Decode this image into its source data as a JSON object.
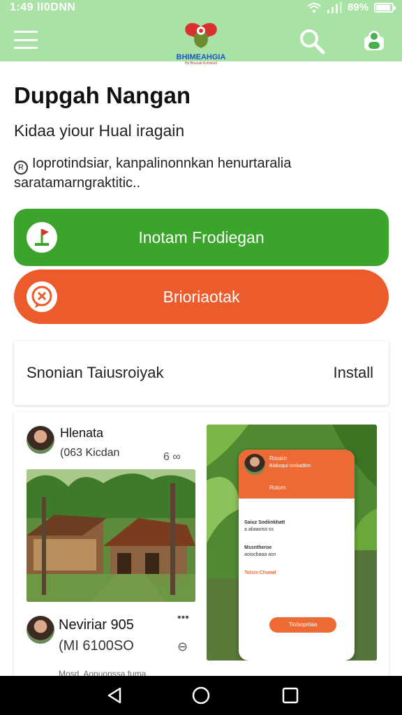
{
  "status_bar": {
    "time": "1:49 lI0DNN",
    "battery": "89%",
    "battery_level": 0.85
  },
  "app_bar": {
    "menu_icon": "hamburger-menu-icon",
    "logo": {
      "text": "BHIMEAHGIA",
      "subtext": "Hp Bnuvak Kohsiwet"
    },
    "search_icon": "search-icon",
    "profile_icon": "profile-icon"
  },
  "header": {
    "title": "Dupgah Nangan",
    "subtitle": "Kidaa yiour Hual iragain",
    "description": "Ioprotindsiar, kanpalinonnkan henurtaralia saratamarngraktitic..",
    "description_icon": "info-icon"
  },
  "buttons": {
    "primary": {
      "label": "Inotam Frodiegan",
      "icon": "flag-icon",
      "color": "#3aa52a"
    },
    "secondary": {
      "label": "Brioriaotak",
      "icon": "chat-bubble-icon",
      "color": "#ec5b2b"
    }
  },
  "install_card": {
    "label": "Snonian Taiusroiyak",
    "action": "Install"
  },
  "feed": {
    "posts": [
      {
        "name": "Hlenata",
        "meta": "(063 Kicdan",
        "action": "6 ∞"
      },
      {
        "name": "Neviriar 905",
        "meta": "(MI 6100SO",
        "action": "⊖",
        "more": "•••"
      }
    ],
    "footer_text": "Mosd. Aopuonssa fuma",
    "phone_preview": {
      "header_title": "Rousin",
      "header_sub": "Blakoqui Ionkadtim",
      "tab_label": "Rolom",
      "list_items": [
        {
          "title": "Saiuz Sodiinkhatt",
          "sub": "a aliaaoiss ss"
        },
        {
          "title": "Mssntheroe",
          "sub": "aoiocbaaa asn"
        },
        {
          "title": "Tolsis Chunal",
          "sub": ""
        }
      ],
      "bottom_button": "Tiolsopriiaa"
    }
  },
  "nav": {
    "back_icon": "back-triangle-icon",
    "home_icon": "home-circle-icon",
    "recents_icon": "recents-square-icon"
  }
}
